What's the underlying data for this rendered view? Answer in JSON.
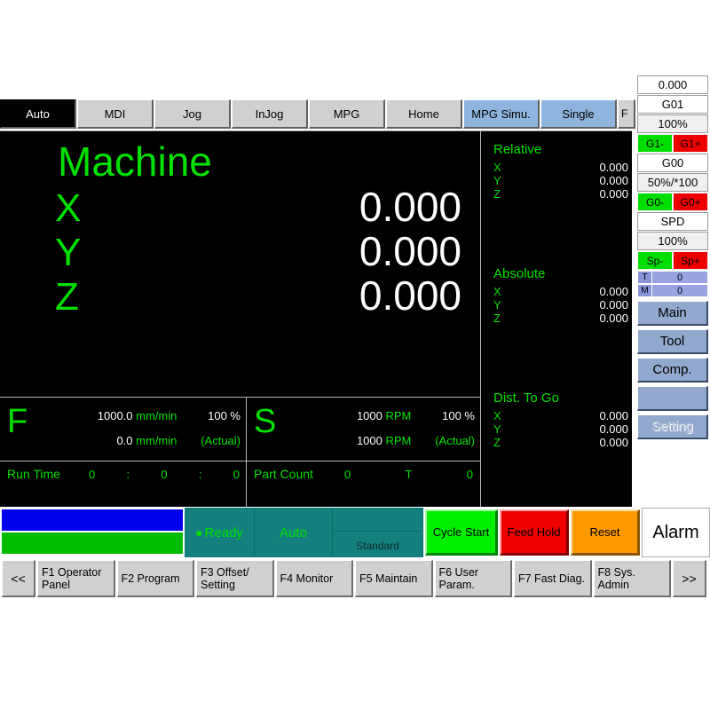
{
  "tabs": [
    {
      "label": "Auto",
      "state": "active"
    },
    {
      "label": "MDI",
      "state": "normal"
    },
    {
      "label": "Jog",
      "state": "normal"
    },
    {
      "label": "InJog",
      "state": "normal"
    },
    {
      "label": "MPG",
      "state": "normal"
    },
    {
      "label": "Home",
      "state": "normal"
    },
    {
      "label": "MPG Simu.",
      "state": "selected"
    },
    {
      "label": "Single",
      "state": "selected"
    },
    {
      "label": "F",
      "state": "clipped"
    }
  ],
  "machine": {
    "title": "Machine",
    "axes": [
      "X",
      "Y",
      "Z"
    ],
    "values": [
      "0.000",
      "0.000",
      "0.000"
    ]
  },
  "coord_groups": [
    {
      "title": "Relative",
      "rows": [
        {
          "axis": "X",
          "value": "0.000"
        },
        {
          "axis": "Y",
          "value": "0.000"
        },
        {
          "axis": "Z",
          "value": "0.000"
        }
      ]
    },
    {
      "title": "Absolute",
      "rows": [
        {
          "axis": "X",
          "value": "0.000"
        },
        {
          "axis": "Y",
          "value": "0.000"
        },
        {
          "axis": "Z",
          "value": "0.000"
        }
      ]
    },
    {
      "title": "Dist. To Go",
      "rows": [
        {
          "axis": "X",
          "value": "0.000"
        },
        {
          "axis": "Y",
          "value": "0.000"
        },
        {
          "axis": "Z",
          "value": "0.000"
        }
      ]
    }
  ],
  "feed": {
    "letter": "F",
    "commanded_value": "1000.0",
    "commanded_unit": "mm/min",
    "override": "100 %",
    "actual_value": "0.0",
    "actual_unit": "mm/min",
    "actual_label": "(Actual)",
    "footer_label": "Run Time",
    "run_time": [
      "0",
      ":",
      "0",
      ":",
      "0"
    ]
  },
  "spindle": {
    "letter": "S",
    "commanded_value": "1000",
    "commanded_unit": "RPM",
    "override": "100 %",
    "actual_value": "1000",
    "actual_unit": "RPM",
    "actual_label": "(Actual)",
    "footer_label": "Part Count",
    "part_count": "0",
    "tool_label": "T",
    "tool_value": "0"
  },
  "sidepanel": {
    "feed_value": "0.000",
    "feed_mode": "G01",
    "feed_pct": "100%",
    "feed_dec": "G1-",
    "feed_inc": "G1+",
    "rapid_mode": "G00",
    "rapid_pct": "50%/*100",
    "rapid_dec": "G0-",
    "rapid_inc": "G0+",
    "spd_label": "SPD",
    "spd_pct": "100%",
    "spd_dec": "Sp-",
    "spd_inc": "Sp+",
    "t_key": "T",
    "t_value": "0",
    "m_key": "M",
    "m_value": "0",
    "buttons": [
      "Main",
      "Tool",
      "Comp.",
      "",
      "Setting"
    ]
  },
  "statusbar": {
    "ready": "Ready",
    "mode": "Auto",
    "standard": "Standard",
    "cycle_start": "Cycle Start",
    "feed_hold": "Feed Hold",
    "reset": "Reset",
    "alarm": "Alarm"
  },
  "fkeys": {
    "prev": "<<",
    "next": ">>",
    "items": [
      "F1 Operator Panel",
      "F2 Program",
      "F3 Offset/ Setting",
      "F4 Monitor",
      "F5 Maintain",
      "F6 User Param.",
      "F7 Fast Diag.",
      "F8 Sys. Admin"
    ]
  },
  "colors": {
    "screen_bg": "#000000",
    "axis_green": "#00e000",
    "value_white": "#ffffff",
    "tab_selected": "#8fb4dd",
    "dec_green": "#00dd00",
    "inc_red": "#ee0000",
    "teal": "#13807e",
    "bar_blue": "#0000ee",
    "bar_green": "#00bb00",
    "reset_orange": "#ff9900"
  }
}
